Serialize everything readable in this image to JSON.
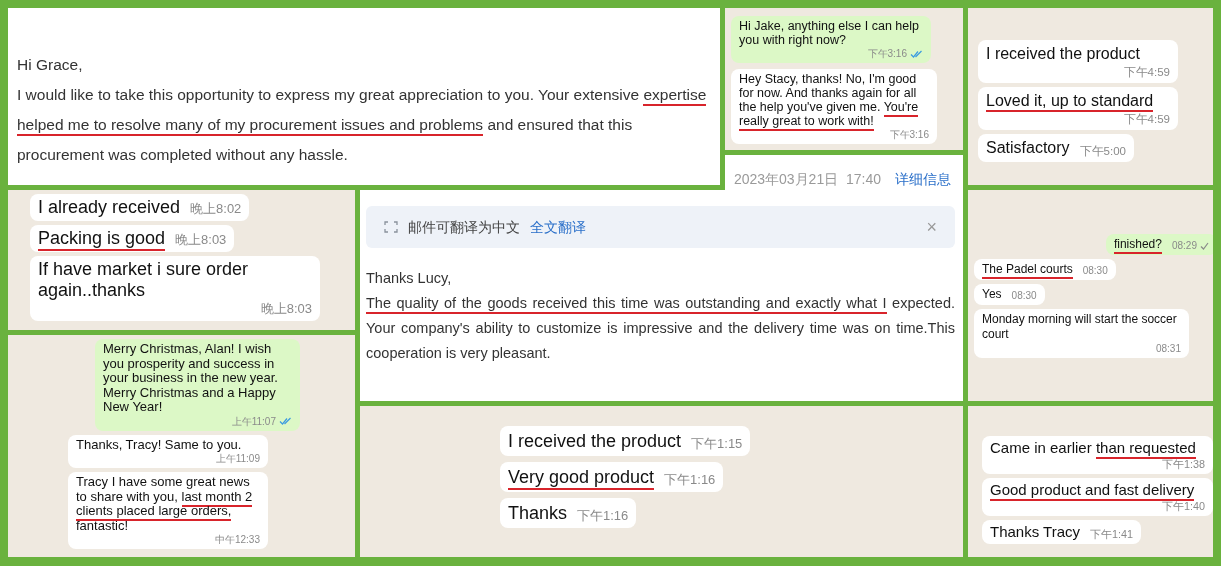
{
  "panels": [
    {
      "kind": "email",
      "greeting": "Hi Grace,",
      "body": [
        {
          "text": "I would like to take this opportunity to express my great appreciation to you. Your extensive ",
          "underlined": false
        },
        {
          "text": "expertise helped me to resolve many of my procurement issues and problems",
          "underlined": true
        },
        {
          "text": " and ensured that this procurement was completed without any hassle.",
          "underlined": false
        }
      ]
    },
    {
      "kind": "chat",
      "messages": [
        {
          "outgoing": true,
          "parts": [
            {
              "text": "Hi Jake, anything else I can help you with right now?",
              "underlined": false
            }
          ],
          "time": "下午3:16",
          "read": true
        },
        {
          "outgoing": false,
          "parts": [
            {
              "text": "Hey Stacy, thanks! No, I'm good for now. And thanks again for all the help you've given me. ",
              "underlined": false
            },
            {
              "text": "You're really great to work with!",
              "underlined": true
            }
          ],
          "time": "下午3:16"
        }
      ]
    },
    {
      "kind": "chat",
      "messages": [
        {
          "outgoing": false,
          "parts": [
            {
              "text": "I received the product",
              "underlined": false
            }
          ],
          "time": "下午4:59"
        },
        {
          "outgoing": false,
          "parts": [
            {
              "text": "Loved it, up to standard",
              "underlined": true
            }
          ],
          "time": "下午4:59"
        },
        {
          "outgoing": false,
          "parts": [
            {
              "text": "Satisfactory",
              "underlined": false
            }
          ],
          "time": "下午5:00"
        }
      ]
    },
    {
      "kind": "chat",
      "messages": [
        {
          "outgoing": false,
          "parts": [
            {
              "text": "I already received",
              "underlined": false
            }
          ],
          "time": "晚上8:02"
        },
        {
          "outgoing": false,
          "parts": [
            {
              "text": "Packing is good",
              "underlined": true
            }
          ],
          "time": "晚上8:03"
        },
        {
          "outgoing": false,
          "parts": [
            {
              "text": "If have market i sure order again..thanks",
              "underlined": false
            }
          ],
          "time": "晚上8:03"
        }
      ]
    },
    {
      "kind": "email",
      "date": "2023年03月21日  17:40",
      "details_link": "详细信息",
      "translate_notice": "邮件可翻译为中文",
      "translate_link": "全文翻译",
      "close": "×",
      "greeting": "Thanks Lucy,",
      "body": [
        {
          "text": "The quality of the goods received this time was outstanding and exactly what I",
          "underlined": true
        },
        {
          "text": " expected. Your company's ability to customize is impressive and the delivery time was on time.This cooperation is very pleasant.",
          "underlined": false
        }
      ]
    },
    {
      "kind": "chat",
      "messages": [
        {
          "outgoing": true,
          "parts": [
            {
              "text": "finished?",
              "underlined": true
            }
          ],
          "time": "08:29",
          "read": false
        },
        {
          "outgoing": false,
          "parts": [
            {
              "text": "The Padel courts",
              "underlined": true
            }
          ],
          "time": "08:30"
        },
        {
          "outgoing": false,
          "parts": [
            {
              "text": "Yes",
              "underlined": false
            }
          ],
          "time": "08:30"
        },
        {
          "outgoing": false,
          "parts": [
            {
              "text": "Monday morning will start the soccer court",
              "underlined": false
            }
          ],
          "time": "08:31"
        }
      ]
    },
    {
      "kind": "chat",
      "messages": [
        {
          "outgoing": true,
          "parts": [
            {
              "text": "Merry Christmas, Alan! I wish you prosperity and success in your business in the new year. Merry Christmas and a Happy New Year!",
              "underlined": false
            }
          ],
          "time": "上午11:07",
          "read": true
        },
        {
          "outgoing": false,
          "parts": [
            {
              "text": "Thanks, Tracy! Same to you.",
              "underlined": false
            }
          ],
          "time": "上午11:09"
        },
        {
          "outgoing": false,
          "parts": [
            {
              "text": "Tracy I have some great news to share with you, ",
              "underlined": false
            },
            {
              "text": "last month 2 clients placed large orders,",
              "underlined": true
            },
            {
              "text": " fantastic!",
              "underlined": false
            }
          ],
          "time": "中午12:33"
        }
      ]
    },
    {
      "kind": "chat",
      "messages": [
        {
          "outgoing": false,
          "parts": [
            {
              "text": "I received the product",
              "underlined": false
            }
          ],
          "time": "下午1:15"
        },
        {
          "outgoing": false,
          "parts": [
            {
              "text": "Very good product",
              "underlined": true
            }
          ],
          "time": "下午1:16"
        },
        {
          "outgoing": false,
          "parts": [
            {
              "text": "Thanks",
              "underlined": false
            }
          ],
          "time": "下午1:16"
        }
      ]
    },
    {
      "kind": "chat",
      "messages": [
        {
          "outgoing": false,
          "parts": [
            {
              "text": "Came in earlier ",
              "underlined": false
            },
            {
              "text": "than requested",
              "underlined": true
            }
          ],
          "time": "下午1:38"
        },
        {
          "outgoing": false,
          "parts": [
            {
              "text": "Good product and fast delivery",
              "underlined": true
            }
          ],
          "time": "下午1:40"
        },
        {
          "outgoing": false,
          "parts": [
            {
              "text": "Thanks Tracy",
              "underlined": false
            }
          ],
          "time": "下午1:41"
        }
      ]
    }
  ]
}
